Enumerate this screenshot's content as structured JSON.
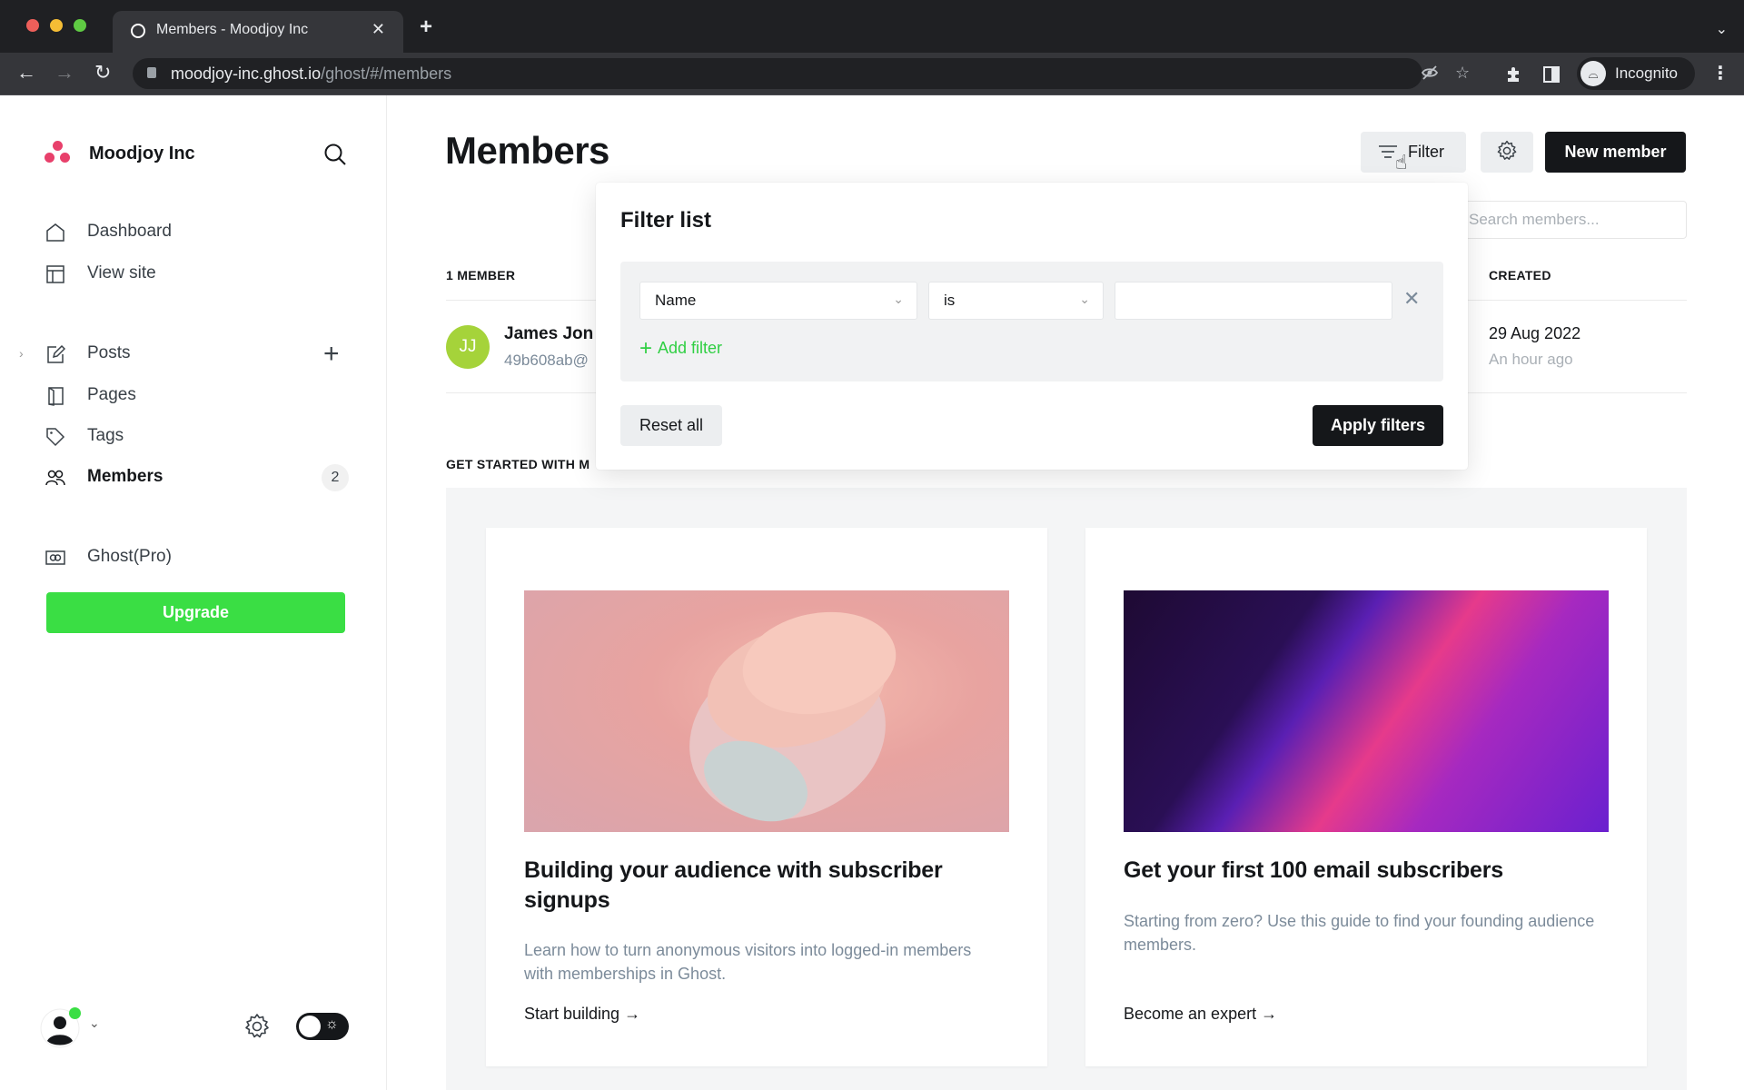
{
  "browser": {
    "tab_title": "Members - Moodjoy Inc",
    "url_host": "moodjoy-inc.ghost.io",
    "url_path": "/ghost/#/members",
    "profile_label": "Incognito"
  },
  "sidebar": {
    "brand_name": "Moodjoy Inc",
    "brand_color": "#e8406b",
    "items": [
      {
        "label": "Dashboard",
        "icon": "home-icon"
      },
      {
        "label": "View site",
        "icon": "layout-icon"
      },
      {
        "label": "Posts",
        "icon": "edit-icon"
      },
      {
        "label": "Pages",
        "icon": "pages-icon"
      },
      {
        "label": "Tags",
        "icon": "tag-icon"
      },
      {
        "label": "Members",
        "icon": "members-icon",
        "count": "2",
        "active": true
      },
      {
        "label": "Ghost(Pro)",
        "icon": "ghost-pro-icon"
      }
    ],
    "upgrade_label": "Upgrade",
    "upgrade_color": "#3ade44"
  },
  "main": {
    "title": "Members",
    "filter_label": "Filter",
    "new_member_label": "New member",
    "search_placeholder": "Search members...",
    "member_count": "1 MEMBER",
    "col_created": "CREATED",
    "members": [
      {
        "initials": "JJ",
        "name": "James Jon",
        "email": "49b608ab@",
        "created": "29 Aug 2022",
        "created_relative": "An hour ago",
        "avatar_color": "#a5d33a"
      }
    ],
    "get_started_heading": "GET STARTED WITH M",
    "cards": [
      {
        "title": "Building your audience with subscriber signups",
        "description": "Learn how to turn anonymous visitors into logged-in members with memberships in Ghost.",
        "link": "Start building →"
      },
      {
        "title": "Get your first 100 email subscribers",
        "description": "Starting from zero? Use this guide to find your founding audience members.",
        "link": "Become an expert →"
      }
    ]
  },
  "filter_popover": {
    "title": "Filter list",
    "field_value": "Name",
    "operator_value": "is",
    "value_input": "",
    "add_filter_label": "Add filter",
    "reset_label": "Reset all",
    "apply_label": "Apply filters",
    "accent_color": "#30cf43"
  }
}
